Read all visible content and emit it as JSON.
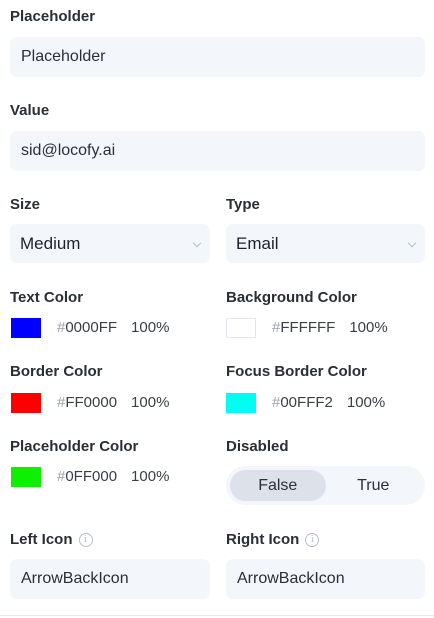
{
  "placeholder": {
    "label": "Placeholder",
    "value": "Placeholder"
  },
  "value": {
    "label": "Value",
    "value": "sid@locofy.ai"
  },
  "size": {
    "label": "Size",
    "selected": "Medium"
  },
  "type": {
    "label": "Type",
    "selected": "Email"
  },
  "text_color": {
    "label": "Text Color",
    "hex": "0000FF",
    "opacity": "100%",
    "swatch": "#0000FF"
  },
  "background_color": {
    "label": "Background Color",
    "hex": "FFFFFF",
    "opacity": "100%",
    "swatch": "#FFFFFF"
  },
  "border_color": {
    "label": "Border Color",
    "hex": "FF0000",
    "opacity": "100%",
    "swatch": "#FF0000"
  },
  "focus_border_color": {
    "label": "Focus Border Color",
    "hex": "00FFF2",
    "opacity": "100%",
    "swatch": "#00FFF2"
  },
  "placeholder_color": {
    "label": "Placeholder Color",
    "hex": "0FF000",
    "opacity": "100%",
    "swatch": "#0FF000"
  },
  "disabled": {
    "label": "Disabled",
    "options": [
      "False",
      "True"
    ],
    "selected": "False"
  },
  "left_icon": {
    "label": "Left Icon",
    "value": "ArrowBackIcon"
  },
  "right_icon": {
    "label": "Right Icon",
    "value": "ArrowBackIcon"
  },
  "hash": "#",
  "icons": {
    "info": "info-icon",
    "chevron": "chevron-down-icon"
  }
}
